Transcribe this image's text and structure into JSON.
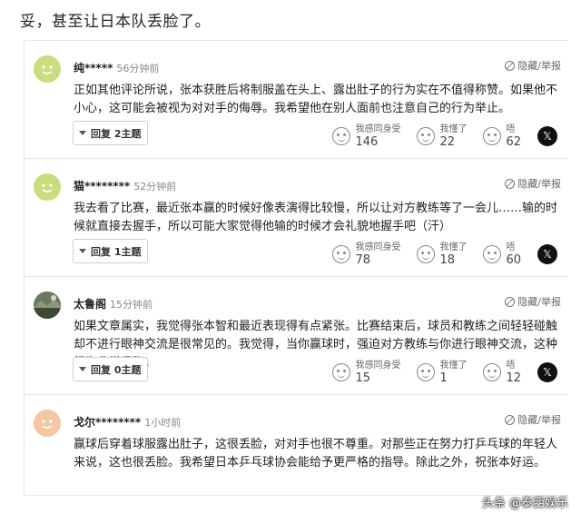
{
  "headline": "妥，甚至让日本队丢脸了。",
  "report_label": "隐藏/举报",
  "reaction_labels": {
    "relate": "我感同身受",
    "understand": "我懂了",
    "sigh": "唔"
  },
  "x_icon": "x-logo-icon",
  "comments": [
    {
      "user": "纯*****",
      "time": "56分钟前",
      "body": "正如其他评论所说，张本获胜后将制服盖在头上、露出肚子的行为实在不值得称赞。如果他不小心，这可能会被视为对对手的侮辱。我希望他在别人面前也注意自己的行为举止。",
      "replies": "回复 2主题",
      "counts": {
        "relate": "146",
        "understand": "22",
        "sigh": "62"
      },
      "avatar": "green"
    },
    {
      "user": "猫********",
      "time": "52分钟前",
      "body": "我去看了比赛，最近张本赢的时候好像表演得比较慢，所以让对方教练等了一会儿……输的时候就直接去握手，所以可能大家觉得他输的时候才会礼貌地握手吧（汗）",
      "replies": "回复 1主题",
      "counts": {
        "relate": "78",
        "understand": "18",
        "sigh": "60"
      },
      "avatar": "green"
    },
    {
      "user": "太鲁阁",
      "time": "15分钟前",
      "body": "如果文章属实，我觉得张本智和最近表现得有点紧张。比赛结束后，球员和教练之间轻轻碰触却不进行眼神交流是很常见的。我觉得，当你赢球时，强迫对方教练与你进行眼神交流，这种行为非常紧张。",
      "replies": "回复 0主题",
      "counts": {
        "relate": "15",
        "understand": "1",
        "sigh": "12"
      },
      "avatar": "photo"
    },
    {
      "user": "戈尔********",
      "time": "1小时前",
      "body": "赢球后穿着球服露出肚子，这很丢脸，对对手也很不尊重。对那些正在努力打乒乓球的年轻人来说，这也很丢脸。我希望日本乒乓球协会能给予更严格的指导。除此之外，祝张本好运。",
      "avatar": "peach"
    }
  ],
  "watermark": "头条 @泰西娱乐"
}
